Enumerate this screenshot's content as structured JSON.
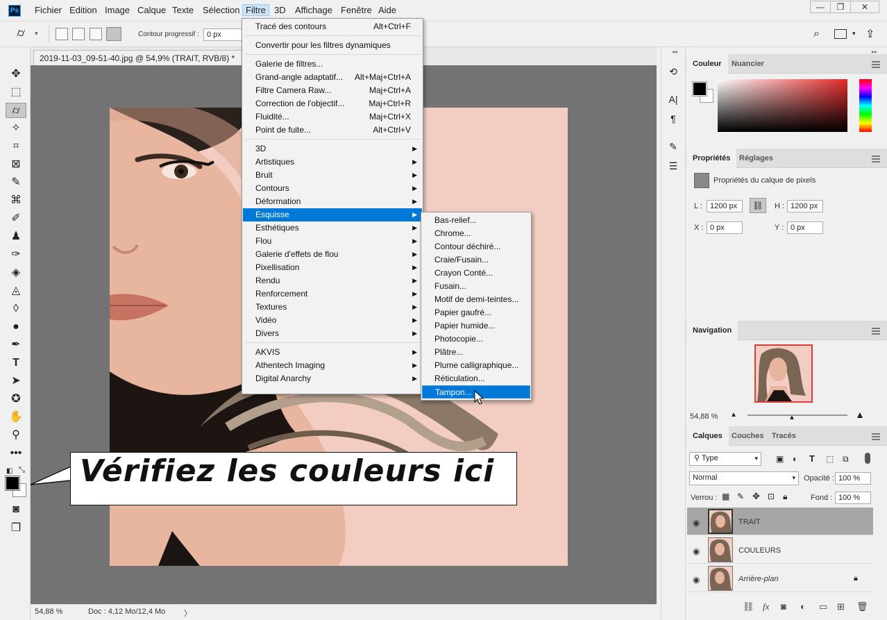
{
  "app": {
    "logo": "Ps"
  },
  "menubar": {
    "items": [
      "Fichier",
      "Edition",
      "Image",
      "Calque",
      "Texte",
      "Sélection",
      "Filtre",
      "3D",
      "Affichage",
      "Fenêtre",
      "Aide"
    ],
    "active": "Filtre",
    "window_controls": [
      "—",
      "❐",
      "✕"
    ]
  },
  "options_bar": {
    "feather_label": "Contour progressif :",
    "feather_value": "0 px",
    "icons": [
      "polygonal-lasso-icon",
      "chevron-down-icon",
      "new-selection-icon",
      "add-selection-icon",
      "subtract-selection-icon",
      "intersect-selection-icon",
      "search-icon",
      "workspace-icon",
      "share-icon"
    ]
  },
  "document": {
    "tab_title": "2019-11-03_09-51-40.jpg @ 54,9% (TRAIT, RVB/8) *",
    "tab_close": "✕"
  },
  "statusbar": {
    "zoom": "54,88 %",
    "doc_info": "Doc : 4,12 Mo/12,4 Mo",
    "arrow": "〉"
  },
  "filter_menu": {
    "items": [
      {
        "label": "Tracé des contours",
        "shortcut": "Alt+Ctrl+F"
      },
      {
        "sep": true
      },
      {
        "label": "Convertir pour les filtres dynamiques"
      },
      {
        "sep": true
      },
      {
        "label": "Galerie de filtres..."
      },
      {
        "label": "Grand-angle adaptatif...",
        "shortcut": "Alt+Maj+Ctrl+A"
      },
      {
        "label": "Filtre Camera Raw...",
        "shortcut": "Maj+Ctrl+A"
      },
      {
        "label": "Correction de l'objectif...",
        "shortcut": "Maj+Ctrl+R"
      },
      {
        "label": "Fluidité...",
        "shortcut": "Maj+Ctrl+X"
      },
      {
        "label": "Point de fuite...",
        "shortcut": "Alt+Ctrl+V"
      },
      {
        "sep": true
      },
      {
        "label": "3D",
        "sub": true
      },
      {
        "label": "Artistiques",
        "sub": true
      },
      {
        "label": "Bruit",
        "sub": true
      },
      {
        "label": "Contours",
        "sub": true
      },
      {
        "label": "Déformation",
        "sub": true
      },
      {
        "label": "Esquisse",
        "sub": true,
        "highlighted": true
      },
      {
        "label": "Esthétiques",
        "sub": true
      },
      {
        "label": "Flou",
        "sub": true
      },
      {
        "label": "Galerie d'effets de flou",
        "sub": true
      },
      {
        "label": "Pixellisation",
        "sub": true
      },
      {
        "label": "Rendu",
        "sub": true
      },
      {
        "label": "Renforcement",
        "sub": true
      },
      {
        "label": "Textures",
        "sub": true
      },
      {
        "label": "Vidéo",
        "sub": true
      },
      {
        "label": "Divers",
        "sub": true
      },
      {
        "sep": true
      },
      {
        "label": "AKVIS",
        "sub": true
      },
      {
        "label": "Athentech Imaging",
        "sub": true
      },
      {
        "label": "Digital Anarchy",
        "sub": true
      }
    ]
  },
  "esquisse_submenu": {
    "items": [
      "Bas-relief...",
      "Chrome...",
      "Contour déchiré...",
      "Craie/Fusain...",
      "Crayon Conté...",
      "Fusain...",
      "Motif de demi-teintes...",
      "Papier gaufré...",
      "Papier humide...",
      "Photocopie...",
      "Plâtre...",
      "Plume calligraphique...",
      "Réticulation...",
      "Tampon..."
    ],
    "highlighted": "Tampon..."
  },
  "callout": {
    "text": "Vérifiez les couleurs ici"
  },
  "panels": {
    "color": {
      "tabs": [
        "Couleur",
        "Nuancier"
      ],
      "foreground": "#000000",
      "background": "#ffffff"
    },
    "properties": {
      "tabs": [
        "Propriétés",
        "Réglages"
      ],
      "title": "Propriétés du calque de pixels",
      "w_label": "L :",
      "w_value": "1200 px",
      "h_label": "H :",
      "h_value": "1200 px",
      "x_label": "X :",
      "x_value": "0 px",
      "y_label": "Y :",
      "y_value": "0 px"
    },
    "navigation": {
      "tab": "Navigation",
      "zoom": "54,88 %"
    },
    "layers": {
      "tabs": [
        "Calques",
        "Couches",
        "Tracés"
      ],
      "filter_type": "Type",
      "blend_mode": "Normal",
      "opacity_label": "Opacité :",
      "opacity_value": "100 %",
      "lock_label": "Verrou :",
      "fill_label": "Fond :",
      "fill_value": "100 %",
      "layers": [
        {
          "name": "TRAIT",
          "selected": true
        },
        {
          "name": "COULEURS",
          "selected": false
        },
        {
          "name": "Arrière-plan",
          "selected": false,
          "locked": true,
          "italic": true
        }
      ],
      "bottom_icons": [
        "link-icon",
        "fx-icon",
        "mask-icon",
        "adjustment-icon",
        "folder-icon",
        "new-layer-icon",
        "trash-icon"
      ]
    }
  },
  "colors": {
    "highlight": "#0078d7",
    "canvas_bg": "#737373",
    "skin": "#f2ccc0"
  }
}
